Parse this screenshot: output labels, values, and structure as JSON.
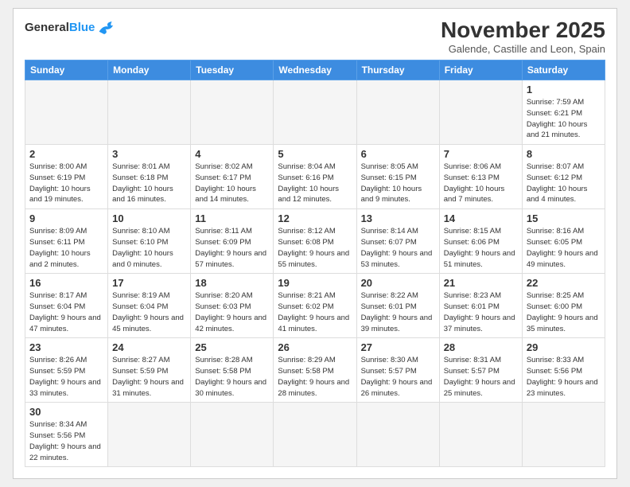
{
  "header": {
    "logo_general": "General",
    "logo_blue": "Blue",
    "month_title": "November 2025",
    "subtitle": "Galende, Castille and Leon, Spain"
  },
  "weekdays": [
    "Sunday",
    "Monday",
    "Tuesday",
    "Wednesday",
    "Thursday",
    "Friday",
    "Saturday"
  ],
  "weeks": [
    [
      {
        "day": "",
        "info": ""
      },
      {
        "day": "",
        "info": ""
      },
      {
        "day": "",
        "info": ""
      },
      {
        "day": "",
        "info": ""
      },
      {
        "day": "",
        "info": ""
      },
      {
        "day": "",
        "info": ""
      },
      {
        "day": "1",
        "info": "Sunrise: 7:59 AM\nSunset: 6:21 PM\nDaylight: 10 hours\nand 21 minutes."
      }
    ],
    [
      {
        "day": "2",
        "info": "Sunrise: 8:00 AM\nSunset: 6:19 PM\nDaylight: 10 hours\nand 19 minutes."
      },
      {
        "day": "3",
        "info": "Sunrise: 8:01 AM\nSunset: 6:18 PM\nDaylight: 10 hours\nand 16 minutes."
      },
      {
        "day": "4",
        "info": "Sunrise: 8:02 AM\nSunset: 6:17 PM\nDaylight: 10 hours\nand 14 minutes."
      },
      {
        "day": "5",
        "info": "Sunrise: 8:04 AM\nSunset: 6:16 PM\nDaylight: 10 hours\nand 12 minutes."
      },
      {
        "day": "6",
        "info": "Sunrise: 8:05 AM\nSunset: 6:15 PM\nDaylight: 10 hours\nand 9 minutes."
      },
      {
        "day": "7",
        "info": "Sunrise: 8:06 AM\nSunset: 6:13 PM\nDaylight: 10 hours\nand 7 minutes."
      },
      {
        "day": "8",
        "info": "Sunrise: 8:07 AM\nSunset: 6:12 PM\nDaylight: 10 hours\nand 4 minutes."
      }
    ],
    [
      {
        "day": "9",
        "info": "Sunrise: 8:09 AM\nSunset: 6:11 PM\nDaylight: 10 hours\nand 2 minutes."
      },
      {
        "day": "10",
        "info": "Sunrise: 8:10 AM\nSunset: 6:10 PM\nDaylight: 10 hours\nand 0 minutes."
      },
      {
        "day": "11",
        "info": "Sunrise: 8:11 AM\nSunset: 6:09 PM\nDaylight: 9 hours\nand 57 minutes."
      },
      {
        "day": "12",
        "info": "Sunrise: 8:12 AM\nSunset: 6:08 PM\nDaylight: 9 hours\nand 55 minutes."
      },
      {
        "day": "13",
        "info": "Sunrise: 8:14 AM\nSunset: 6:07 PM\nDaylight: 9 hours\nand 53 minutes."
      },
      {
        "day": "14",
        "info": "Sunrise: 8:15 AM\nSunset: 6:06 PM\nDaylight: 9 hours\nand 51 minutes."
      },
      {
        "day": "15",
        "info": "Sunrise: 8:16 AM\nSunset: 6:05 PM\nDaylight: 9 hours\nand 49 minutes."
      }
    ],
    [
      {
        "day": "16",
        "info": "Sunrise: 8:17 AM\nSunset: 6:04 PM\nDaylight: 9 hours\nand 47 minutes."
      },
      {
        "day": "17",
        "info": "Sunrise: 8:19 AM\nSunset: 6:04 PM\nDaylight: 9 hours\nand 45 minutes."
      },
      {
        "day": "18",
        "info": "Sunrise: 8:20 AM\nSunset: 6:03 PM\nDaylight: 9 hours\nand 42 minutes."
      },
      {
        "day": "19",
        "info": "Sunrise: 8:21 AM\nSunset: 6:02 PM\nDaylight: 9 hours\nand 41 minutes."
      },
      {
        "day": "20",
        "info": "Sunrise: 8:22 AM\nSunset: 6:01 PM\nDaylight: 9 hours\nand 39 minutes."
      },
      {
        "day": "21",
        "info": "Sunrise: 8:23 AM\nSunset: 6:01 PM\nDaylight: 9 hours\nand 37 minutes."
      },
      {
        "day": "22",
        "info": "Sunrise: 8:25 AM\nSunset: 6:00 PM\nDaylight: 9 hours\nand 35 minutes."
      }
    ],
    [
      {
        "day": "23",
        "info": "Sunrise: 8:26 AM\nSunset: 5:59 PM\nDaylight: 9 hours\nand 33 minutes."
      },
      {
        "day": "24",
        "info": "Sunrise: 8:27 AM\nSunset: 5:59 PM\nDaylight: 9 hours\nand 31 minutes."
      },
      {
        "day": "25",
        "info": "Sunrise: 8:28 AM\nSunset: 5:58 PM\nDaylight: 9 hours\nand 30 minutes."
      },
      {
        "day": "26",
        "info": "Sunrise: 8:29 AM\nSunset: 5:58 PM\nDaylight: 9 hours\nand 28 minutes."
      },
      {
        "day": "27",
        "info": "Sunrise: 8:30 AM\nSunset: 5:57 PM\nDaylight: 9 hours\nand 26 minutes."
      },
      {
        "day": "28",
        "info": "Sunrise: 8:31 AM\nSunset: 5:57 PM\nDaylight: 9 hours\nand 25 minutes."
      },
      {
        "day": "29",
        "info": "Sunrise: 8:33 AM\nSunset: 5:56 PM\nDaylight: 9 hours\nand 23 minutes."
      }
    ],
    [
      {
        "day": "30",
        "info": "Sunrise: 8:34 AM\nSunset: 5:56 PM\nDaylight: 9 hours\nand 22 minutes."
      },
      {
        "day": "",
        "info": ""
      },
      {
        "day": "",
        "info": ""
      },
      {
        "day": "",
        "info": ""
      },
      {
        "day": "",
        "info": ""
      },
      {
        "day": "",
        "info": ""
      },
      {
        "day": "",
        "info": ""
      }
    ]
  ]
}
